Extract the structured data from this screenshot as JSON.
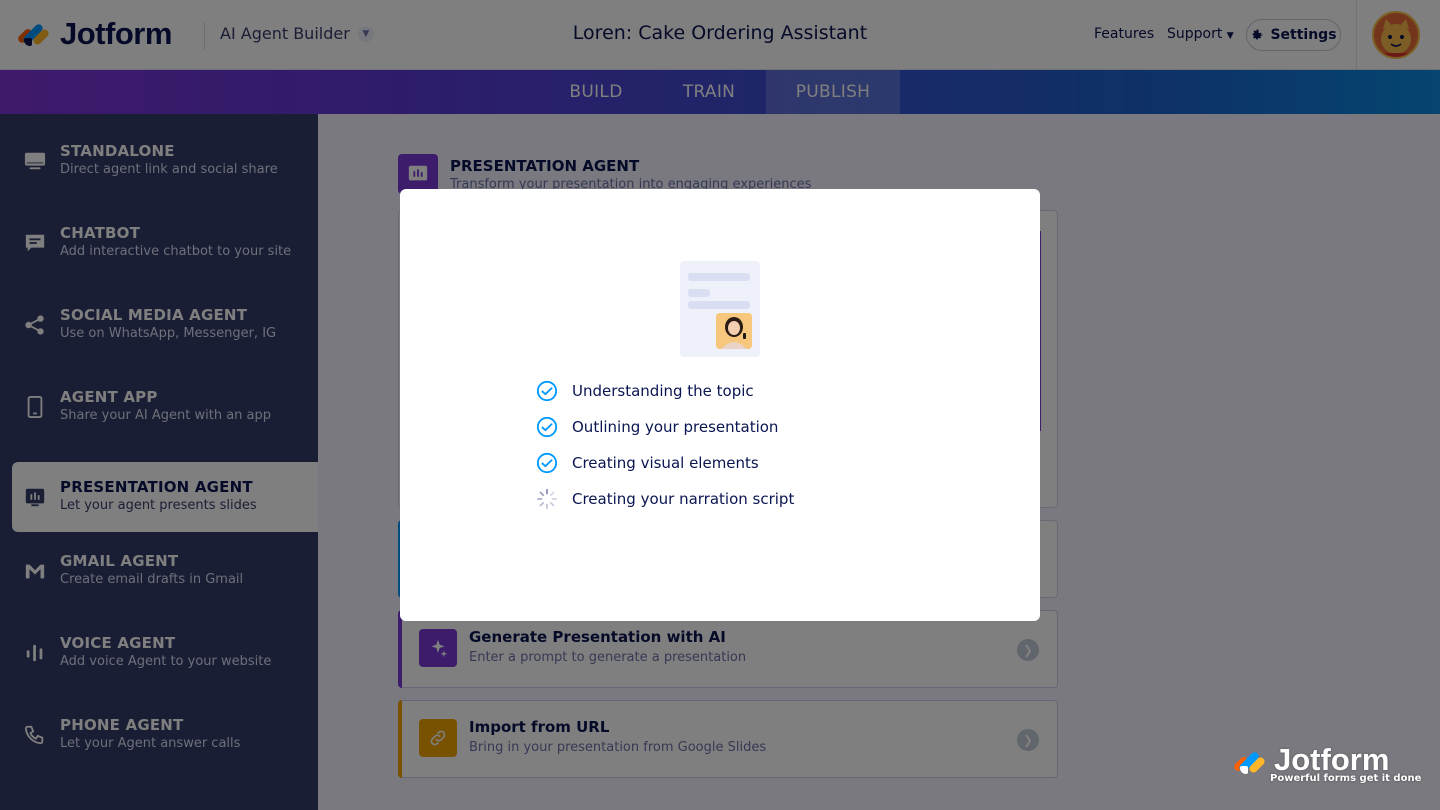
{
  "header": {
    "logo_text": "Jotform",
    "builder_label": "AI Agent Builder",
    "title": "Loren: Cake Ordering Assistant",
    "features_label": "Features",
    "support_label": "Support",
    "settings_label": "Settings"
  },
  "tabs": [
    {
      "label": "BUILD"
    },
    {
      "label": "TRAIN"
    },
    {
      "label": "PUBLISH"
    }
  ],
  "active_tab": "PUBLISH",
  "sidebar": {
    "items": [
      {
        "title": "STANDALONE",
        "desc": "Direct agent link and social share",
        "icon": "monitor-icon"
      },
      {
        "title": "CHATBOT",
        "desc": "Add interactive chatbot to your site",
        "icon": "chat-icon"
      },
      {
        "title": "SOCIAL MEDIA AGENT",
        "desc": "Use on WhatsApp, Messenger, IG",
        "icon": "share-icon"
      },
      {
        "title": "AGENT APP",
        "desc": "Share your AI Agent with an app",
        "icon": "phone-icon"
      },
      {
        "title": "PRESENTATION AGENT",
        "desc": "Let your agent presents slides",
        "icon": "presentation-icon"
      },
      {
        "title": "GMAIL AGENT",
        "desc": "Create email drafts in Gmail",
        "icon": "gmail-icon"
      },
      {
        "title": "VOICE AGENT",
        "desc": "Add voice Agent to your website",
        "icon": "voice-bars-icon"
      },
      {
        "title": "PHONE AGENT",
        "desc": "Let your Agent answer calls",
        "icon": "phone-call-icon"
      }
    ],
    "active_index": 4
  },
  "main": {
    "title": "PRESENTATION AGENT",
    "subtitle": "Transform your presentation into engaging experiences",
    "options": [
      {
        "title": "Generate Presentation with AI",
        "desc": "Enter a prompt to generate a presentation",
        "icon": "sparkle-icon",
        "color": "#7b38d8"
      },
      {
        "title": "Import from URL",
        "desc": "Bring in your presentation from Google Slides",
        "icon": "link-icon",
        "color": "#f0a500"
      }
    ]
  },
  "modal": {
    "steps": [
      {
        "label": "Understanding the topic",
        "status": "done"
      },
      {
        "label": "Outlining your presentation",
        "status": "done"
      },
      {
        "label": "Creating visual elements",
        "status": "done"
      },
      {
        "label": "Creating your narration script",
        "status": "loading"
      }
    ]
  },
  "watermark": {
    "text": "Jotform",
    "tagline": "Powerful forms get it done"
  },
  "colors": {
    "navy": "#0a1551",
    "sidebar": "#343c6a",
    "check_blue": "#0099ff",
    "purple": "#7b38d8",
    "orange": "#f0a500"
  }
}
